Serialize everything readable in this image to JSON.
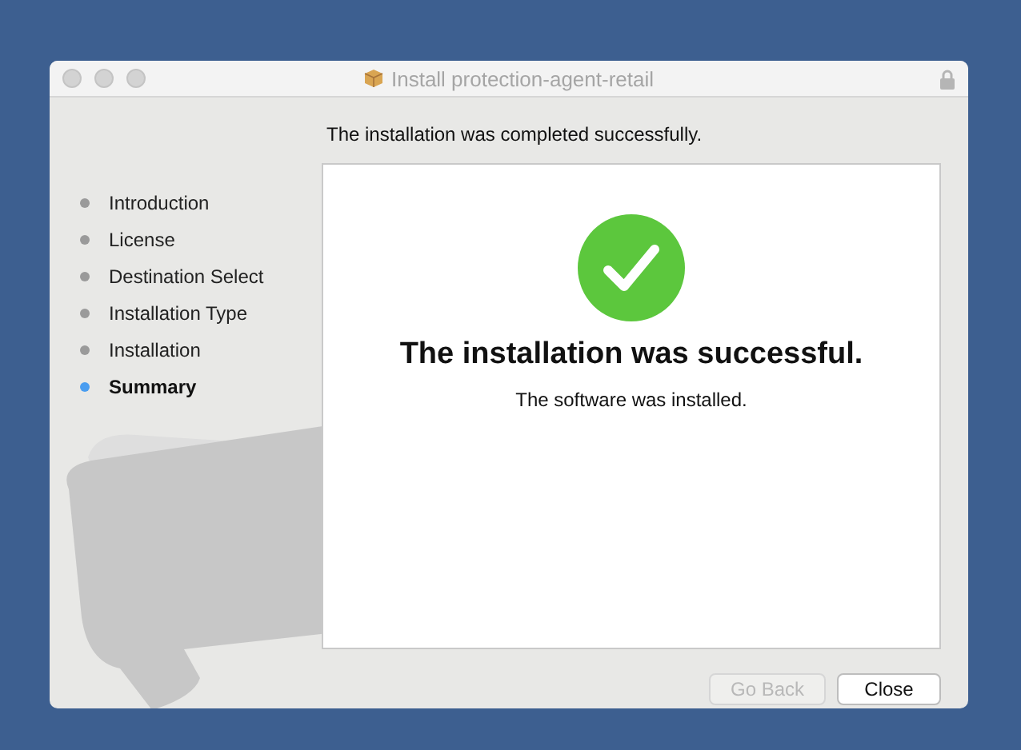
{
  "window": {
    "title": "Install protection-agent-retail"
  },
  "sidebar": {
    "items": [
      {
        "label": "Introduction",
        "selected": false
      },
      {
        "label": "License",
        "selected": false
      },
      {
        "label": "Destination Select",
        "selected": false
      },
      {
        "label": "Installation Type",
        "selected": false
      },
      {
        "label": "Installation",
        "selected": false
      },
      {
        "label": "Summary",
        "selected": true
      }
    ]
  },
  "header": "The installation was completed successfully.",
  "panel": {
    "title": "The installation was successful.",
    "message": "The software was installed."
  },
  "buttons": [
    {
      "label": "Go Back",
      "disabled": true
    },
    {
      "label": "Close",
      "disabled": false
    }
  ]
}
